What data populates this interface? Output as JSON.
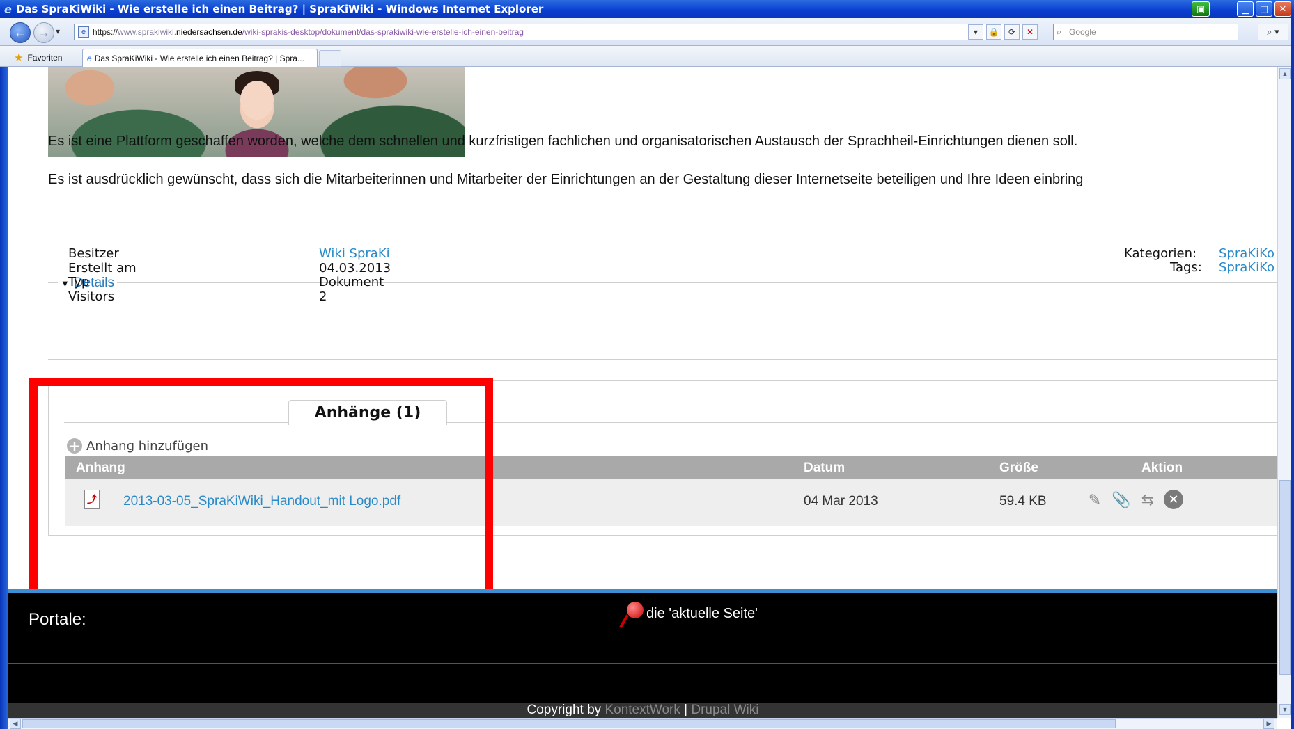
{
  "window": {
    "title": "Das SpraKiWiki - Wie erstelle ich einen Beitrag? | SpraKiWiki - Windows Internet Explorer"
  },
  "address_bar": {
    "url_scheme": "https://",
    "url_sub": "www.sprakiwiki.",
    "url_domain": "niedersachsen.de",
    "url_path": "/wiki-sprakis-desktop/dokument/das-sprakiwiki-wie-erstelle-ich-einen-beitrag",
    "search_placeholder": "Google"
  },
  "favorites_bar": {
    "favorites_label": "Favoriten",
    "tab_title": "Das SpraKiWiki - Wie erstelle ich einen Beitrag? | Spra..."
  },
  "content": {
    "paragraph_1": "Es ist eine Plattform geschaffen worden, welche dem schnellen und kurzfristigen fachlichen und organisatorischen Austausch der Sprachheil-Einrichtungen dienen soll.",
    "paragraph_2": "Es ist ausdrücklich gewünscht, dass sich die Mitarbeiterinnen und Mitarbeiter der Einrichtungen an der Gestaltung dieser Internetseite beteiligen und Ihre Ideen einbring"
  },
  "details": {
    "legend": "Details",
    "rows": [
      {
        "label": "Besitzer",
        "value": "Wiki SpraKi"
      },
      {
        "label": "Erstellt am",
        "value": "04.03.2013"
      },
      {
        "label": "Typ",
        "value": "Dokument"
      },
      {
        "label": "Visitors",
        "value": "2"
      }
    ],
    "kategorien_label": "Kategorien:",
    "kategorien_value": "SpraKiKo",
    "tags_label": "Tags:",
    "tags_value": "SpraKiKo"
  },
  "attachments": {
    "tab_label": "Anhänge (1)",
    "add_label": "Anhang hinzufügen",
    "headers": {
      "name": "Anhang",
      "date": "Datum",
      "size": "Größe",
      "action": "Aktion"
    },
    "rows": [
      {
        "name": "2013-03-05_SpraKiWiki_Handout_mit Logo.pdf",
        "date": "04 Mar 2013",
        "size": "59.4 KB"
      }
    ]
  },
  "footer": {
    "portale": "Portale:",
    "current_page": "die 'aktuelle Seite'",
    "copyright_prefix": "Copyright by ",
    "copyright_link1": "KontextWork",
    "copyright_sep": " | ",
    "copyright_link2": "Drupal Wiki"
  },
  "colors": {
    "link": "#2a8ac8",
    "highlight": "#ff0000",
    "footer_bg": "#000000",
    "table_header": "#a9a9a9"
  }
}
